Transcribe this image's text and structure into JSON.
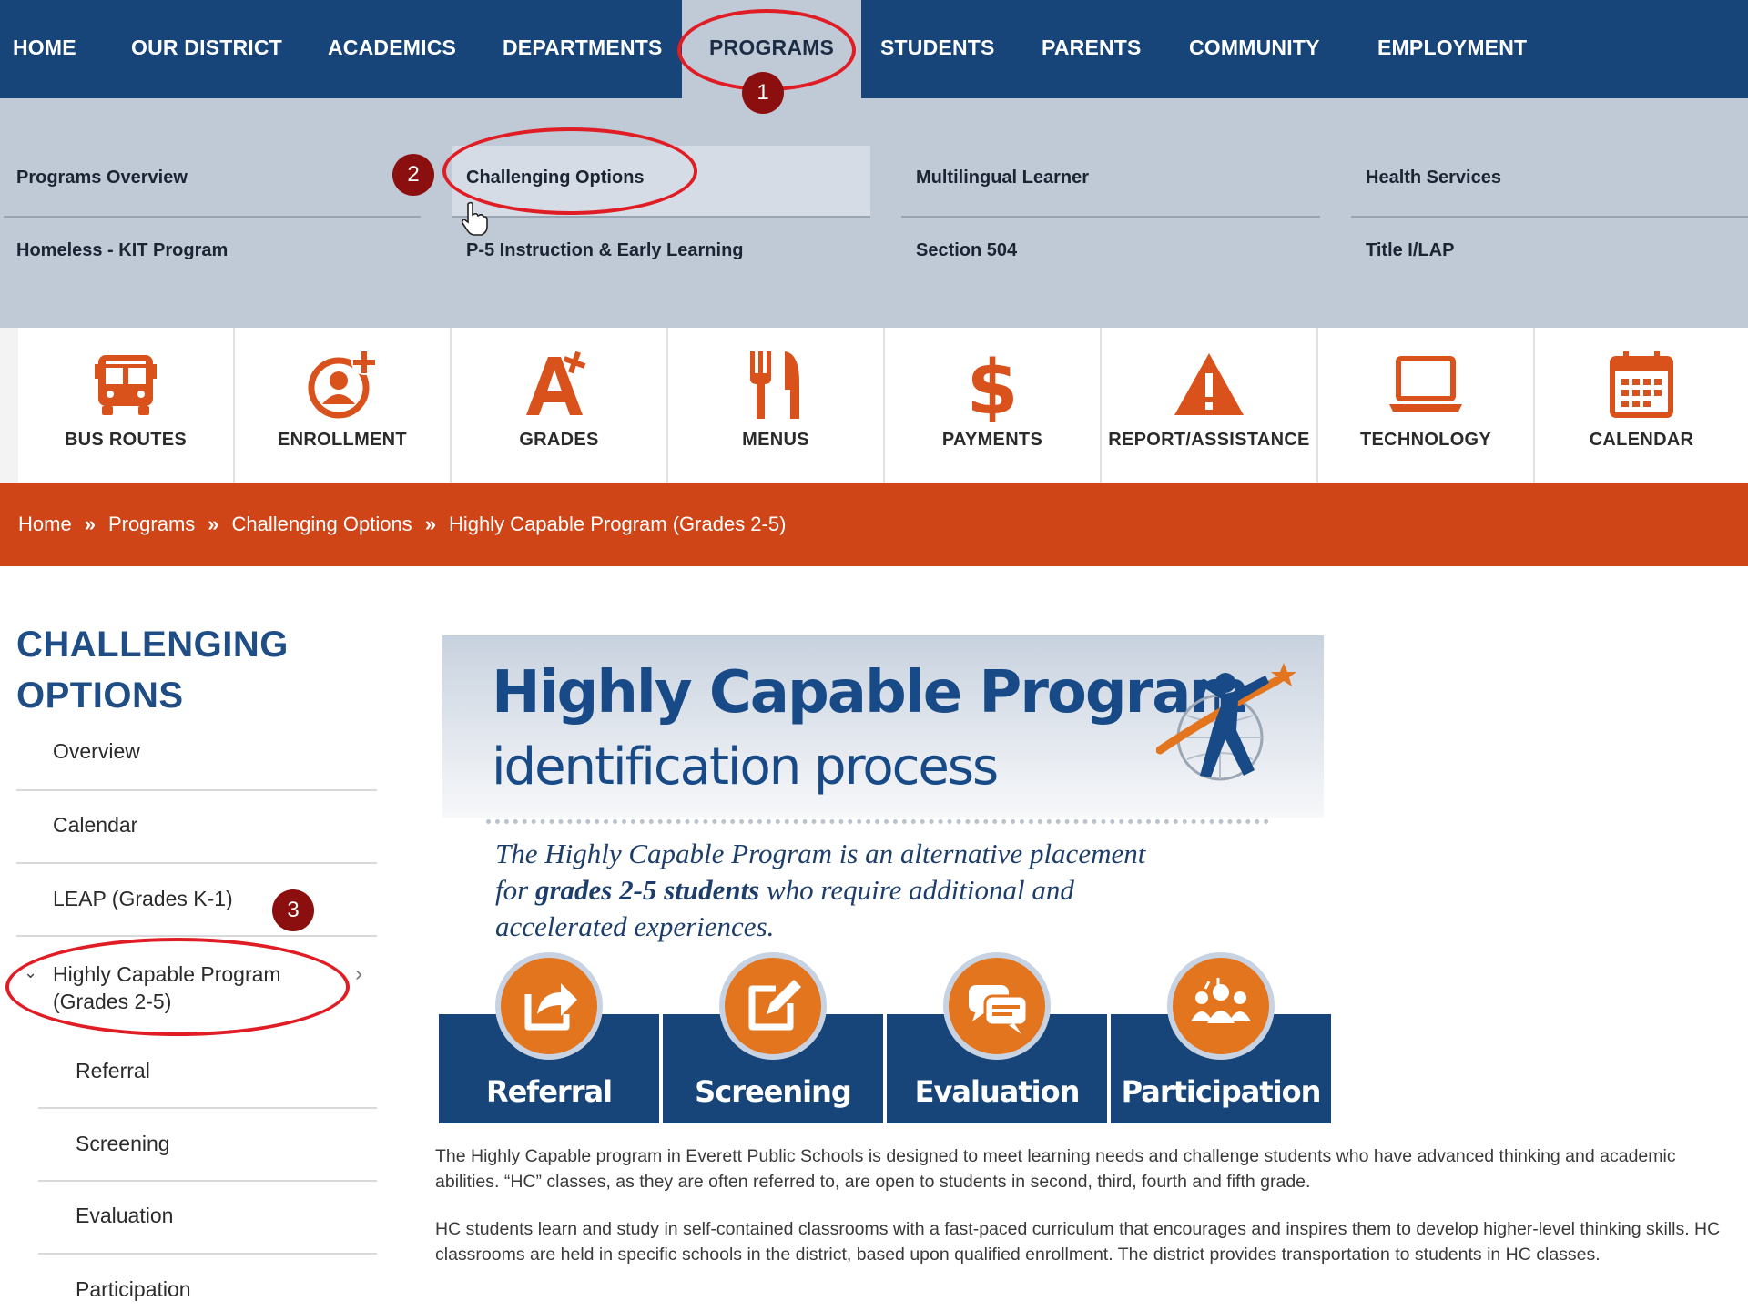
{
  "topnav": {
    "items": [
      "HOME",
      "OUR DISTRICT",
      "ACADEMICS",
      "DEPARTMENTS",
      "PROGRAMS",
      "STUDENTS",
      "PARENTS",
      "COMMUNITY",
      "EMPLOYMENT"
    ],
    "active": "PROGRAMS"
  },
  "megamenu": {
    "row1": [
      "Programs Overview",
      "Challenging Options",
      "Multilingual Learner",
      "Health Services"
    ],
    "row2": [
      "Homeless - KIT Program",
      "P-5 Instruction & Early Learning",
      "Section 504",
      "Title I/LAP"
    ],
    "highlighted": "Challenging Options"
  },
  "quicklinks": [
    {
      "label": "BUS ROUTES",
      "icon": "bus-icon"
    },
    {
      "label": "ENROLLMENT",
      "icon": "add-user-icon"
    },
    {
      "label": "GRADES",
      "icon": "grade-a-plus-icon"
    },
    {
      "label": "MENUS",
      "icon": "fork-knife-icon"
    },
    {
      "label": "PAYMENTS",
      "icon": "dollar-icon"
    },
    {
      "label": "REPORT/ASSISTANCE",
      "icon": "warning-icon"
    },
    {
      "label": "TECHNOLOGY",
      "icon": "laptop-icon"
    },
    {
      "label": "CALENDAR",
      "icon": "calendar-icon"
    }
  ],
  "breadcrumb": {
    "items": [
      "Home",
      "Programs",
      "Challenging Options",
      "Highly Capable Program (Grades 2-5)"
    ],
    "separator": "»"
  },
  "sidebar": {
    "title_line1": "CHALLENGING",
    "title_line2": "OPTIONS",
    "items": [
      "Overview",
      "Calendar",
      "LEAP (Grades K-1)"
    ],
    "expanded": {
      "line1": "Highly Capable Program",
      "line2": "(Grades 2-5)"
    },
    "subitems": [
      "Referral",
      "Screening",
      "Evaluation",
      "Participation"
    ]
  },
  "banner": {
    "title": "Highly Capable Program",
    "subtitle": "identification process",
    "tagline_1": "The Highly Capable Program is an alternative placement",
    "tagline_2a": "for ",
    "tagline_2b": "grades 2-5 students",
    "tagline_2c": " who require additional and",
    "tagline_3": "accelerated experiences.",
    "steps": [
      {
        "label": "Referral",
        "icon": "share-arrow-icon"
      },
      {
        "label": "Screening",
        "icon": "edit-pencil-icon"
      },
      {
        "label": "Evaluation",
        "icon": "chat-bubbles-icon"
      },
      {
        "label": "Participation",
        "icon": "group-people-icon"
      }
    ]
  },
  "content": {
    "p1": "The Highly Capable program in Everett Public Schools is designed to meet learning needs and challenge students who have advanced thinking and academic abilities. “HC” classes, as they are often referred to, are open to students in second, third, fourth and fifth grade.",
    "p2": "HC students learn and study in self-contained classrooms with a fast-paced curriculum that encourages and inspires them to develop higher-level thinking skills. HC classrooms are held in specific schools in the district, based upon qualified enrollment. The district provides transportation to students in HC classes."
  },
  "annotations": {
    "n1": "1",
    "n2": "2",
    "n3": "3"
  },
  "colors": {
    "nav": "#17457a",
    "menu": "#c0cad6",
    "accent": "#d04517",
    "icon": "#d9521c",
    "annotation": "#e01c24"
  }
}
